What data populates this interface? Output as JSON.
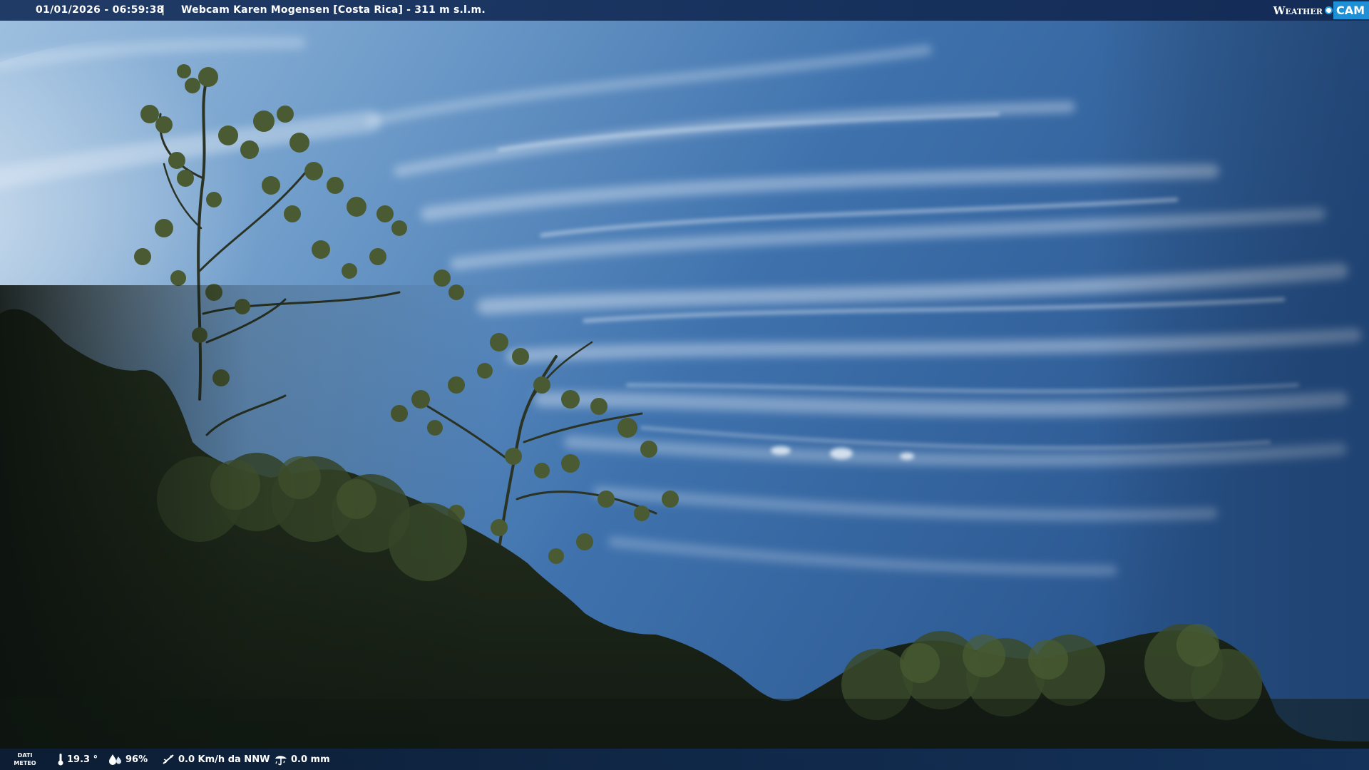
{
  "header": {
    "datetime": "01/01/2026 - 06:59:38",
    "separator": "|",
    "station": "Webcam Karen Mogensen [Costa Rica] - 311 m s.l.m."
  },
  "logo": {
    "left_text": "Weather",
    "right_text": "CAM",
    "accent_color": "#1f8fd6"
  },
  "weather": {
    "label_line1": "DATI",
    "label_line2": "METEO",
    "temperature": "19.3 °",
    "humidity": "96%",
    "wind": "0.0 Km/h da NNW",
    "rain": "0.0 mm"
  },
  "icons": {
    "temperature": "thermometer-icon",
    "humidity": "water-drops-icon",
    "wind": "wind-vane-icon",
    "rain": "rain-gauge-icon"
  }
}
